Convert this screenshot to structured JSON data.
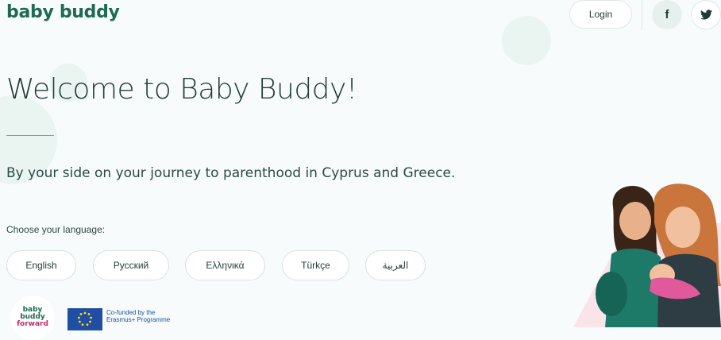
{
  "header": {
    "logo_text": "baby buddy",
    "login_label": "Login",
    "social": [
      {
        "icon": "facebook-icon",
        "glyph": "f"
      },
      {
        "icon": "twitter-icon"
      }
    ]
  },
  "hero": {
    "title": "Welcome to Baby Buddy!",
    "subtitle": "By your side on your journey to parenthood in Cyprus and Greece."
  },
  "language": {
    "prompt": "Choose your language:",
    "options": [
      "English",
      "Русский",
      "Ελληνικά",
      "Türkçe",
      "العربية"
    ]
  },
  "footer": {
    "logo_line1": "baby",
    "logo_line2": "buddy",
    "logo_line3": "forward",
    "eu_text_line1": "Co-funded by the",
    "eu_text_line2": "Erasmus+ Programme"
  },
  "colors": {
    "brand": "#1e6b52",
    "background": "#f7fbfb",
    "accent_pink": "#c22c6b"
  }
}
